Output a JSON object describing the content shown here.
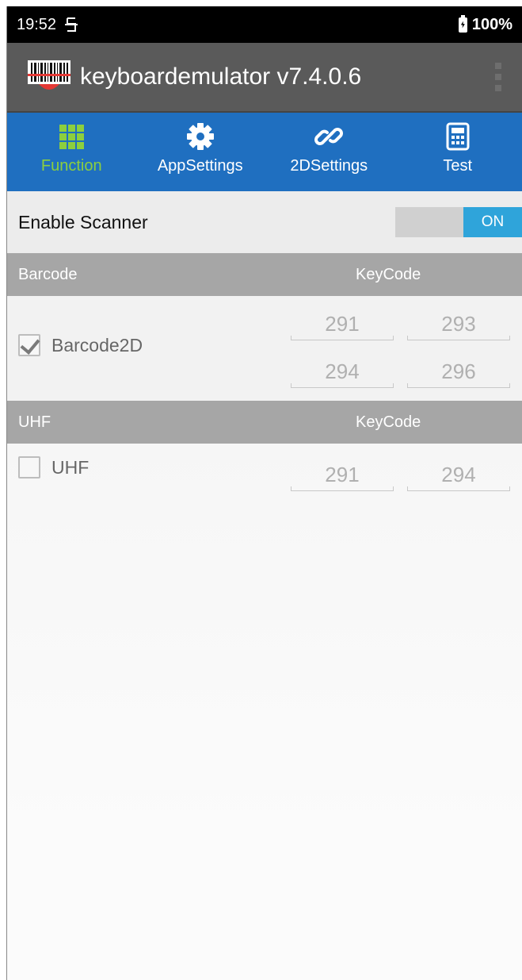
{
  "status_bar": {
    "time": "19:52",
    "battery": "100%"
  },
  "app_bar": {
    "title": "keyboardemulator v7.4.0.6"
  },
  "tabs": [
    {
      "label": "Function",
      "icon": "grid-icon",
      "active": true
    },
    {
      "label": "AppSettings",
      "icon": "gear-icon",
      "active": false
    },
    {
      "label": "2DSettings",
      "icon": "link-icon",
      "active": false
    },
    {
      "label": "Test",
      "icon": "calculator-icon",
      "active": false
    }
  ],
  "enable_scanner": {
    "label": "Enable Scanner",
    "toggle_state": "ON"
  },
  "sections": [
    {
      "header": "Barcode",
      "keycode_header": "KeyCode",
      "item": {
        "label": "Barcode2D",
        "checked": true,
        "keycodes": [
          "291",
          "293",
          "294",
          "296"
        ]
      }
    },
    {
      "header": "UHF",
      "keycode_header": "KeyCode",
      "item": {
        "label": "UHF",
        "checked": false,
        "keycodes": [
          "291",
          "294"
        ]
      }
    }
  ],
  "colors": {
    "tab_bar": "#1f6fc0",
    "active_tab": "#8ccf3e",
    "toggle_on": "#2fa4da",
    "app_bar": "#5a5a5a",
    "section_header": "#a6a6a6"
  }
}
